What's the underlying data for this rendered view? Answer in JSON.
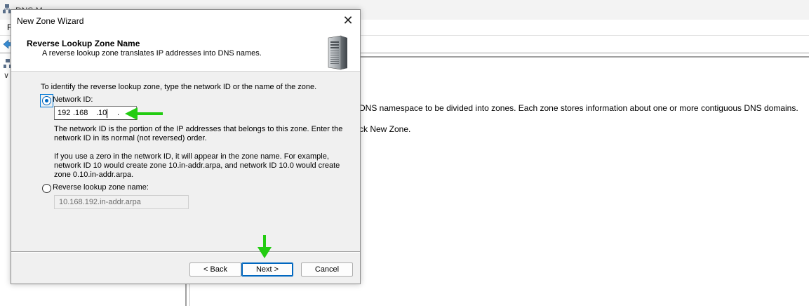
{
  "background_window": {
    "title": "DNS M",
    "menu_first": "F",
    "description_line1": "DNS namespace to be divided into zones. Each zone stores information about one or more contiguous DNS domains.",
    "description_line2": "ck New Zone."
  },
  "dialog": {
    "title": "New Zone Wizard",
    "close_label": "✕",
    "header": {
      "title": "Reverse Lookup Zone Name",
      "subtitle": "A reverse lookup zone translates IP addresses into DNS names."
    },
    "intro": "To identify the reverse lookup zone, type the network ID or the name of the zone.",
    "network_id": {
      "label": "Network ID:",
      "selected": true,
      "octets": [
        "192",
        ".168",
        ".10",
        "."
      ]
    },
    "network_id_description": "The network ID is the portion of the IP addresses that belongs to this zone. Enter the network ID in its normal (not reversed) order.",
    "zero_note": "If you use a zero in the network ID, it will appear in the zone name. For example, network ID 10 would create zone 10.in-addr.arpa, and network ID 10.0 would create zone 0.10.in-addr.arpa.",
    "reverse_zone": {
      "label": "Reverse lookup zone name:",
      "selected": false,
      "value": "10.168.192.in-addr.arpa"
    },
    "buttons": {
      "back": "< Back",
      "next": "Next >",
      "cancel": "Cancel"
    }
  },
  "annotations": {
    "arrow_color": "#22cc11"
  },
  "colors": {
    "accent": "#0067c0",
    "dialog_bg": "#f0f0f0"
  }
}
